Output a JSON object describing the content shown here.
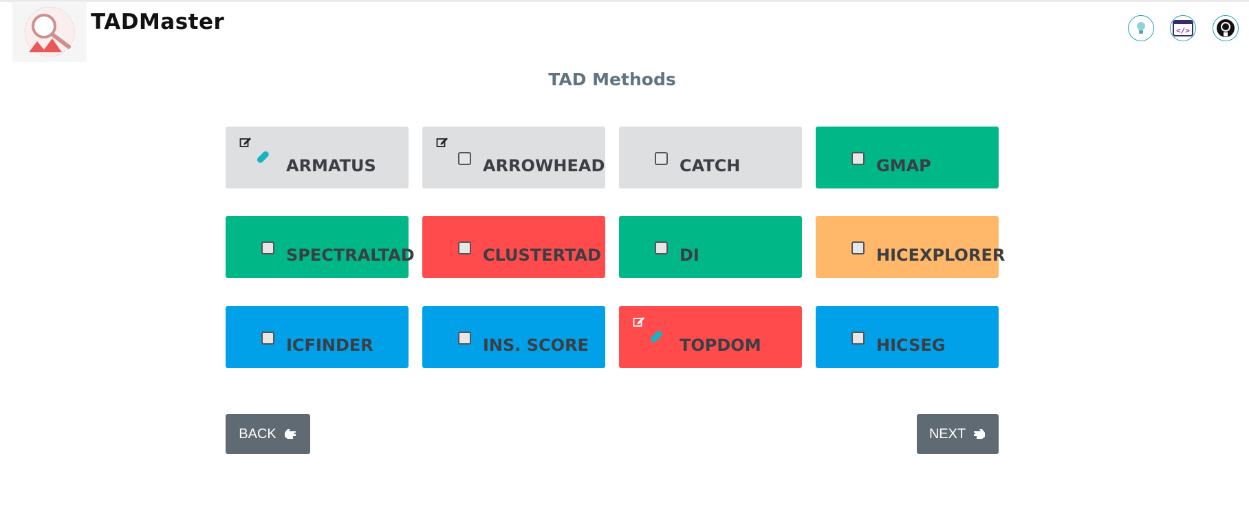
{
  "header": {
    "brand": "TADMaster"
  },
  "page": {
    "title": "TAD Methods"
  },
  "colors": {
    "gray": "#dedfe1",
    "green": "#00b887",
    "red": "#ff4b4b",
    "orange": "#ffb869",
    "blue": "#00a1e9",
    "button": "#5f6a72"
  },
  "methods": [
    {
      "label": "ARMATUS",
      "color": "gray",
      "marker": "pill",
      "edit": true
    },
    {
      "label": "ARROWHEAD",
      "color": "gray",
      "marker": "checkbox",
      "edit": true
    },
    {
      "label": "CATCH",
      "color": "gray",
      "marker": "checkbox",
      "edit": false
    },
    {
      "label": "GMAP",
      "color": "green",
      "marker": "checkbox",
      "edit": false
    },
    {
      "label": "SPECTRALTAD",
      "color": "green",
      "marker": "checkbox",
      "edit": false
    },
    {
      "label": "CLUSTERTAD",
      "color": "red",
      "marker": "checkbox",
      "edit": false
    },
    {
      "label": "DI",
      "color": "green",
      "marker": "checkbox",
      "edit": false
    },
    {
      "label": "HICEXPLORER",
      "color": "orange",
      "marker": "checkbox",
      "edit": false
    },
    {
      "label": "ICFINDER",
      "color": "blue",
      "marker": "checkbox",
      "edit": false
    },
    {
      "label": "INS. SCORE",
      "color": "blue",
      "marker": "checkbox",
      "edit": false
    },
    {
      "label": "TOPDOM",
      "color": "red",
      "marker": "pill",
      "edit": true
    },
    {
      "label": "HICSEG",
      "color": "blue",
      "marker": "checkbox",
      "edit": false
    }
  ],
  "buttons": {
    "back": "BACK",
    "next": "NEXT"
  },
  "icons": [
    "lightbulb-icon",
    "code-icon",
    "github-icon",
    "edit-icon",
    "pill-icon",
    "hand-left-icon",
    "hand-right-icon"
  ]
}
